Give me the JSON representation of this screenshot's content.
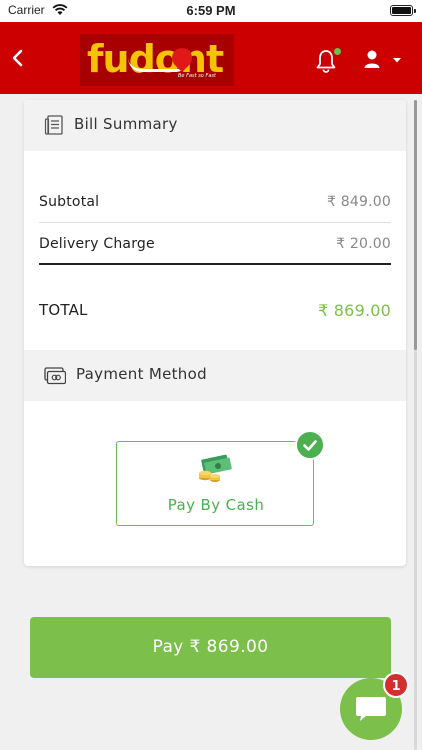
{
  "status_bar": {
    "carrier": "Carrier",
    "time": "6:59 PM",
    "icons": [
      "wifi-icon",
      "battery-icon"
    ]
  },
  "header": {
    "logo_text": "fudont",
    "logo_tagline": "Be Fast so Fast",
    "icons": [
      "back-arrow-icon",
      "bell-icon",
      "user-icon",
      "caret-down-icon"
    ],
    "notification_dot_color": "#6cc04a",
    "background_color": "#cc0000"
  },
  "bill_summary": {
    "title": "Bill Summary",
    "icon": "receipt-icon",
    "rows": [
      {
        "label": "Subtotal",
        "value": "₹ 849.00"
      },
      {
        "label": "Delivery Charge",
        "value": "₹ 20.00"
      }
    ],
    "total": {
      "label": "TOTAL",
      "value": "₹ 869.00"
    }
  },
  "payment_method": {
    "title": "Payment Method",
    "icon": "credit-card-icon",
    "options": [
      {
        "label": "Pay By Cash",
        "icon": "cash-icon",
        "selected": true
      }
    ]
  },
  "pay_button": {
    "label": "Pay ₹ 869.00",
    "color": "#7cbf4a"
  },
  "chat": {
    "icon": "chat-bubble-icon",
    "badge_count": "1"
  }
}
